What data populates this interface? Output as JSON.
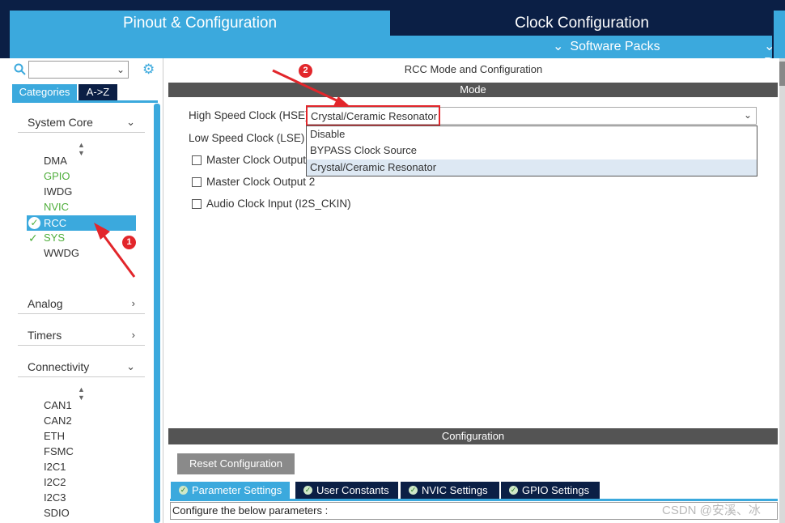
{
  "header": {
    "tab_pinout": "Pinout & Configuration",
    "tab_clock": "Clock Configuration",
    "software_packs": "Software Packs",
    "software_packs_cut": "P"
  },
  "sidebar": {
    "search_value": "",
    "tab_categories": "Categories",
    "tab_az": "A->Z",
    "sections": {
      "system_core": "System Core",
      "analog": "Analog",
      "timers": "Timers",
      "connectivity": "Connectivity"
    },
    "system_core_items": [
      "DMA",
      "GPIO",
      "IWDG",
      "NVIC",
      "RCC",
      "SYS",
      "WWDG"
    ],
    "connectivity_items": [
      "CAN1",
      "CAN2",
      "ETH",
      "FSMC",
      "I2C1",
      "I2C2",
      "I2C3",
      "SDIO"
    ]
  },
  "main": {
    "title": "RCC Mode and Configuration",
    "mode_header": "Mode",
    "hse_label": "High Speed Clock (HSE)",
    "hse_value": "Crystal/Ceramic Resonator",
    "hse_options": [
      "Disable",
      "BYPASS Clock Source",
      "Crystal/Ceramic Resonator"
    ],
    "lse_label": "Low Speed Clock (LSE)",
    "mco1_label": "Master Clock Output",
    "mco2_label": "Master Clock Output 2",
    "audio_label": "Audio Clock Input (I2S_CKIN)"
  },
  "configuration": {
    "header": "Configuration",
    "reset_button": "Reset Configuration",
    "tabs": [
      "Parameter Settings",
      "User Constants",
      "NVIC Settings",
      "GPIO Settings"
    ],
    "params_text": "Configure the below parameters :"
  },
  "annotations": [
    "1",
    "2"
  ],
  "watermark": "CSDN @安溪、冰",
  "colors": {
    "accent_blue": "#3ba9dd",
    "dark_navy": "#0b1f45",
    "green_ok": "#4fae3b",
    "annotation_red": "#e2262b",
    "header_gray": "#545454"
  }
}
